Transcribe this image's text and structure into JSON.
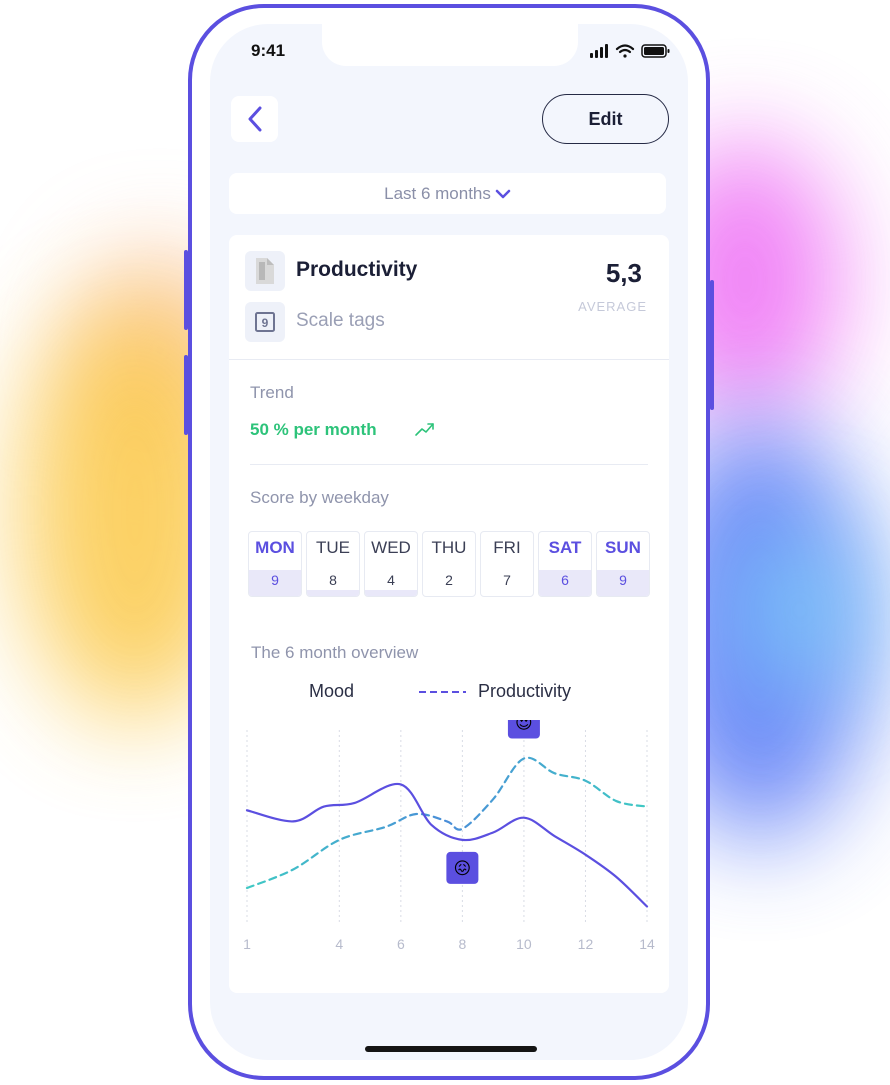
{
  "status": {
    "time": "9:41"
  },
  "header": {
    "back_icon": "chevron-left-icon",
    "edit_label": "Edit"
  },
  "period": {
    "label": "Last 6 months",
    "icon": "chevron-down-icon"
  },
  "tag": {
    "title": "Productivity",
    "icon": "document-icon",
    "subtitle": "Scale tags",
    "subtitle_icon": "scale-tag-icon",
    "average_value": "5,3",
    "average_label": "AVERAGE"
  },
  "trend": {
    "label": "Trend",
    "value": "50 % per month",
    "icon": "trending-up-icon",
    "color": "#2dc37a"
  },
  "weekday_section": {
    "label": "Score  by weekday",
    "days": [
      {
        "name": "MON",
        "score": "9",
        "highlight": true
      },
      {
        "name": "TUE",
        "score": "8",
        "highlight": false
      },
      {
        "name": "WED",
        "score": "4",
        "highlight": false
      },
      {
        "name": "THU",
        "score": "2",
        "highlight": false
      },
      {
        "name": "FRI",
        "score": "7",
        "highlight": false
      },
      {
        "name": "SAT",
        "score": "6",
        "highlight": true
      },
      {
        "name": "SUN",
        "score": "9",
        "highlight": true
      }
    ]
  },
  "overview": {
    "label": "The 6 month overview",
    "legend": [
      {
        "name": "Mood",
        "colors": [
          "#4a63d8",
          "#3fc9c4"
        ]
      },
      {
        "name": "Productivity",
        "colors": [
          "#5b4fe0"
        ]
      }
    ]
  },
  "colors": {
    "accent": "#5b4fe0",
    "positive": "#2dc37a",
    "background": "#f3f6fd"
  },
  "chart_data": {
    "type": "line",
    "x_ticks": [
      "1",
      "4",
      "6",
      "8",
      "10",
      "12",
      "14"
    ],
    "series": [
      {
        "name": "Mood",
        "style": "dashed",
        "x": [
          1,
          2.5,
          4,
          5.5,
          6.5,
          7.5,
          8,
          9,
          10,
          11,
          12,
          13,
          14
        ],
        "values": [
          2.0,
          3.0,
          4.6,
          5.3,
          6.0,
          5.6,
          5.2,
          6.8,
          9.0,
          8.2,
          7.8,
          6.7,
          6.4
        ]
      },
      {
        "name": "Productivity",
        "style": "solid",
        "x": [
          1,
          2.5,
          3.5,
          4.5,
          6,
          7,
          8,
          9,
          10,
          11,
          12,
          13,
          14
        ],
        "values": [
          6.2,
          5.6,
          6.4,
          6.6,
          7.6,
          5.4,
          4.6,
          5.0,
          5.8,
          4.8,
          3.8,
          2.6,
          1.0
        ]
      }
    ],
    "ylim": [
      0,
      10
    ],
    "xlim": [
      1,
      14
    ],
    "grid": true,
    "markers": [
      {
        "series": "Mood",
        "x": 10,
        "emoji": "😍",
        "icon": "heart-eyes-emoji-icon"
      },
      {
        "series": "Productivity",
        "x": 8,
        "emoji": "😖",
        "icon": "frustrated-emoji-icon"
      }
    ]
  }
}
